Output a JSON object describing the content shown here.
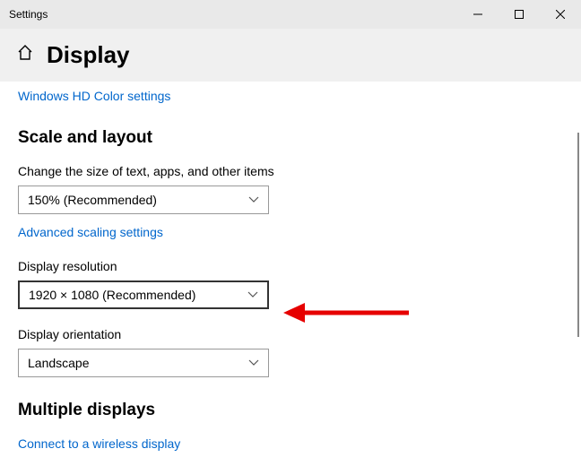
{
  "window": {
    "title": "Settings"
  },
  "header": {
    "title": "Display"
  },
  "links": {
    "hd_color": "Windows HD Color settings",
    "advanced_scaling": "Advanced scaling settings",
    "wireless_display": "Connect to a wireless display"
  },
  "sections": {
    "scale_layout": "Scale and layout",
    "multiple_displays": "Multiple displays"
  },
  "fields": {
    "scale": {
      "label": "Change the size of text, apps, and other items",
      "value": "150% (Recommended)"
    },
    "resolution": {
      "label": "Display resolution",
      "value": "1920 × 1080 (Recommended)"
    },
    "orientation": {
      "label": "Display orientation",
      "value": "Landscape"
    }
  },
  "colors": {
    "link": "#0066cc",
    "accent_arrow": "#e60000"
  }
}
